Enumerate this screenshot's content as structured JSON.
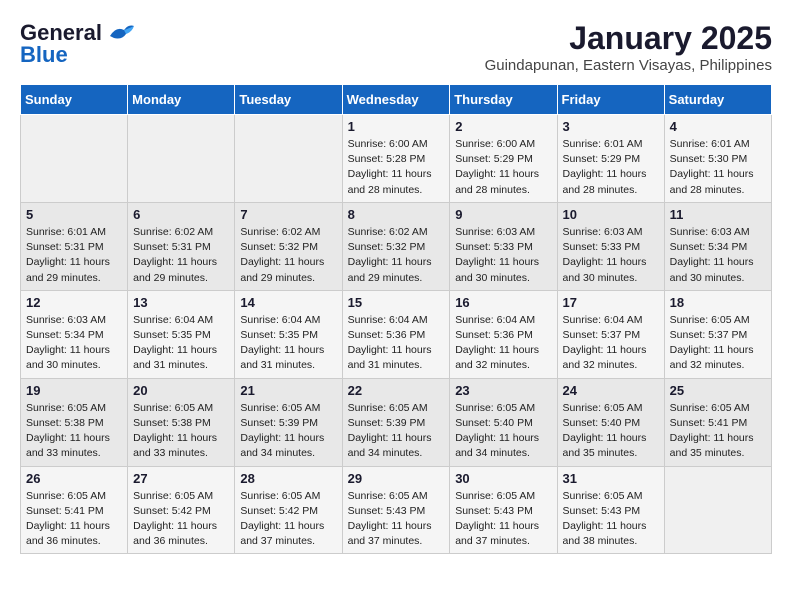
{
  "logo": {
    "line1": "General",
    "line2": "Blue"
  },
  "title": "January 2025",
  "subtitle": "Guindapunan, Eastern Visayas, Philippines",
  "weekdays": [
    "Sunday",
    "Monday",
    "Tuesday",
    "Wednesday",
    "Thursday",
    "Friday",
    "Saturday"
  ],
  "weeks": [
    [
      {
        "day": "",
        "info": ""
      },
      {
        "day": "",
        "info": ""
      },
      {
        "day": "",
        "info": ""
      },
      {
        "day": "1",
        "info": "Sunrise: 6:00 AM\nSunset: 5:28 PM\nDaylight: 11 hours\nand 28 minutes."
      },
      {
        "day": "2",
        "info": "Sunrise: 6:00 AM\nSunset: 5:29 PM\nDaylight: 11 hours\nand 28 minutes."
      },
      {
        "day": "3",
        "info": "Sunrise: 6:01 AM\nSunset: 5:29 PM\nDaylight: 11 hours\nand 28 minutes."
      },
      {
        "day": "4",
        "info": "Sunrise: 6:01 AM\nSunset: 5:30 PM\nDaylight: 11 hours\nand 28 minutes."
      }
    ],
    [
      {
        "day": "5",
        "info": "Sunrise: 6:01 AM\nSunset: 5:31 PM\nDaylight: 11 hours\nand 29 minutes."
      },
      {
        "day": "6",
        "info": "Sunrise: 6:02 AM\nSunset: 5:31 PM\nDaylight: 11 hours\nand 29 minutes."
      },
      {
        "day": "7",
        "info": "Sunrise: 6:02 AM\nSunset: 5:32 PM\nDaylight: 11 hours\nand 29 minutes."
      },
      {
        "day": "8",
        "info": "Sunrise: 6:02 AM\nSunset: 5:32 PM\nDaylight: 11 hours\nand 29 minutes."
      },
      {
        "day": "9",
        "info": "Sunrise: 6:03 AM\nSunset: 5:33 PM\nDaylight: 11 hours\nand 30 minutes."
      },
      {
        "day": "10",
        "info": "Sunrise: 6:03 AM\nSunset: 5:33 PM\nDaylight: 11 hours\nand 30 minutes."
      },
      {
        "day": "11",
        "info": "Sunrise: 6:03 AM\nSunset: 5:34 PM\nDaylight: 11 hours\nand 30 minutes."
      }
    ],
    [
      {
        "day": "12",
        "info": "Sunrise: 6:03 AM\nSunset: 5:34 PM\nDaylight: 11 hours\nand 30 minutes."
      },
      {
        "day": "13",
        "info": "Sunrise: 6:04 AM\nSunset: 5:35 PM\nDaylight: 11 hours\nand 31 minutes."
      },
      {
        "day": "14",
        "info": "Sunrise: 6:04 AM\nSunset: 5:35 PM\nDaylight: 11 hours\nand 31 minutes."
      },
      {
        "day": "15",
        "info": "Sunrise: 6:04 AM\nSunset: 5:36 PM\nDaylight: 11 hours\nand 31 minutes."
      },
      {
        "day": "16",
        "info": "Sunrise: 6:04 AM\nSunset: 5:36 PM\nDaylight: 11 hours\nand 32 minutes."
      },
      {
        "day": "17",
        "info": "Sunrise: 6:04 AM\nSunset: 5:37 PM\nDaylight: 11 hours\nand 32 minutes."
      },
      {
        "day": "18",
        "info": "Sunrise: 6:05 AM\nSunset: 5:37 PM\nDaylight: 11 hours\nand 32 minutes."
      }
    ],
    [
      {
        "day": "19",
        "info": "Sunrise: 6:05 AM\nSunset: 5:38 PM\nDaylight: 11 hours\nand 33 minutes."
      },
      {
        "day": "20",
        "info": "Sunrise: 6:05 AM\nSunset: 5:38 PM\nDaylight: 11 hours\nand 33 minutes."
      },
      {
        "day": "21",
        "info": "Sunrise: 6:05 AM\nSunset: 5:39 PM\nDaylight: 11 hours\nand 34 minutes."
      },
      {
        "day": "22",
        "info": "Sunrise: 6:05 AM\nSunset: 5:39 PM\nDaylight: 11 hours\nand 34 minutes."
      },
      {
        "day": "23",
        "info": "Sunrise: 6:05 AM\nSunset: 5:40 PM\nDaylight: 11 hours\nand 34 minutes."
      },
      {
        "day": "24",
        "info": "Sunrise: 6:05 AM\nSunset: 5:40 PM\nDaylight: 11 hours\nand 35 minutes."
      },
      {
        "day": "25",
        "info": "Sunrise: 6:05 AM\nSunset: 5:41 PM\nDaylight: 11 hours\nand 35 minutes."
      }
    ],
    [
      {
        "day": "26",
        "info": "Sunrise: 6:05 AM\nSunset: 5:41 PM\nDaylight: 11 hours\nand 36 minutes."
      },
      {
        "day": "27",
        "info": "Sunrise: 6:05 AM\nSunset: 5:42 PM\nDaylight: 11 hours\nand 36 minutes."
      },
      {
        "day": "28",
        "info": "Sunrise: 6:05 AM\nSunset: 5:42 PM\nDaylight: 11 hours\nand 37 minutes."
      },
      {
        "day": "29",
        "info": "Sunrise: 6:05 AM\nSunset: 5:43 PM\nDaylight: 11 hours\nand 37 minutes."
      },
      {
        "day": "30",
        "info": "Sunrise: 6:05 AM\nSunset: 5:43 PM\nDaylight: 11 hours\nand 37 minutes."
      },
      {
        "day": "31",
        "info": "Sunrise: 6:05 AM\nSunset: 5:43 PM\nDaylight: 11 hours\nand 38 minutes."
      },
      {
        "day": "",
        "info": ""
      }
    ]
  ]
}
